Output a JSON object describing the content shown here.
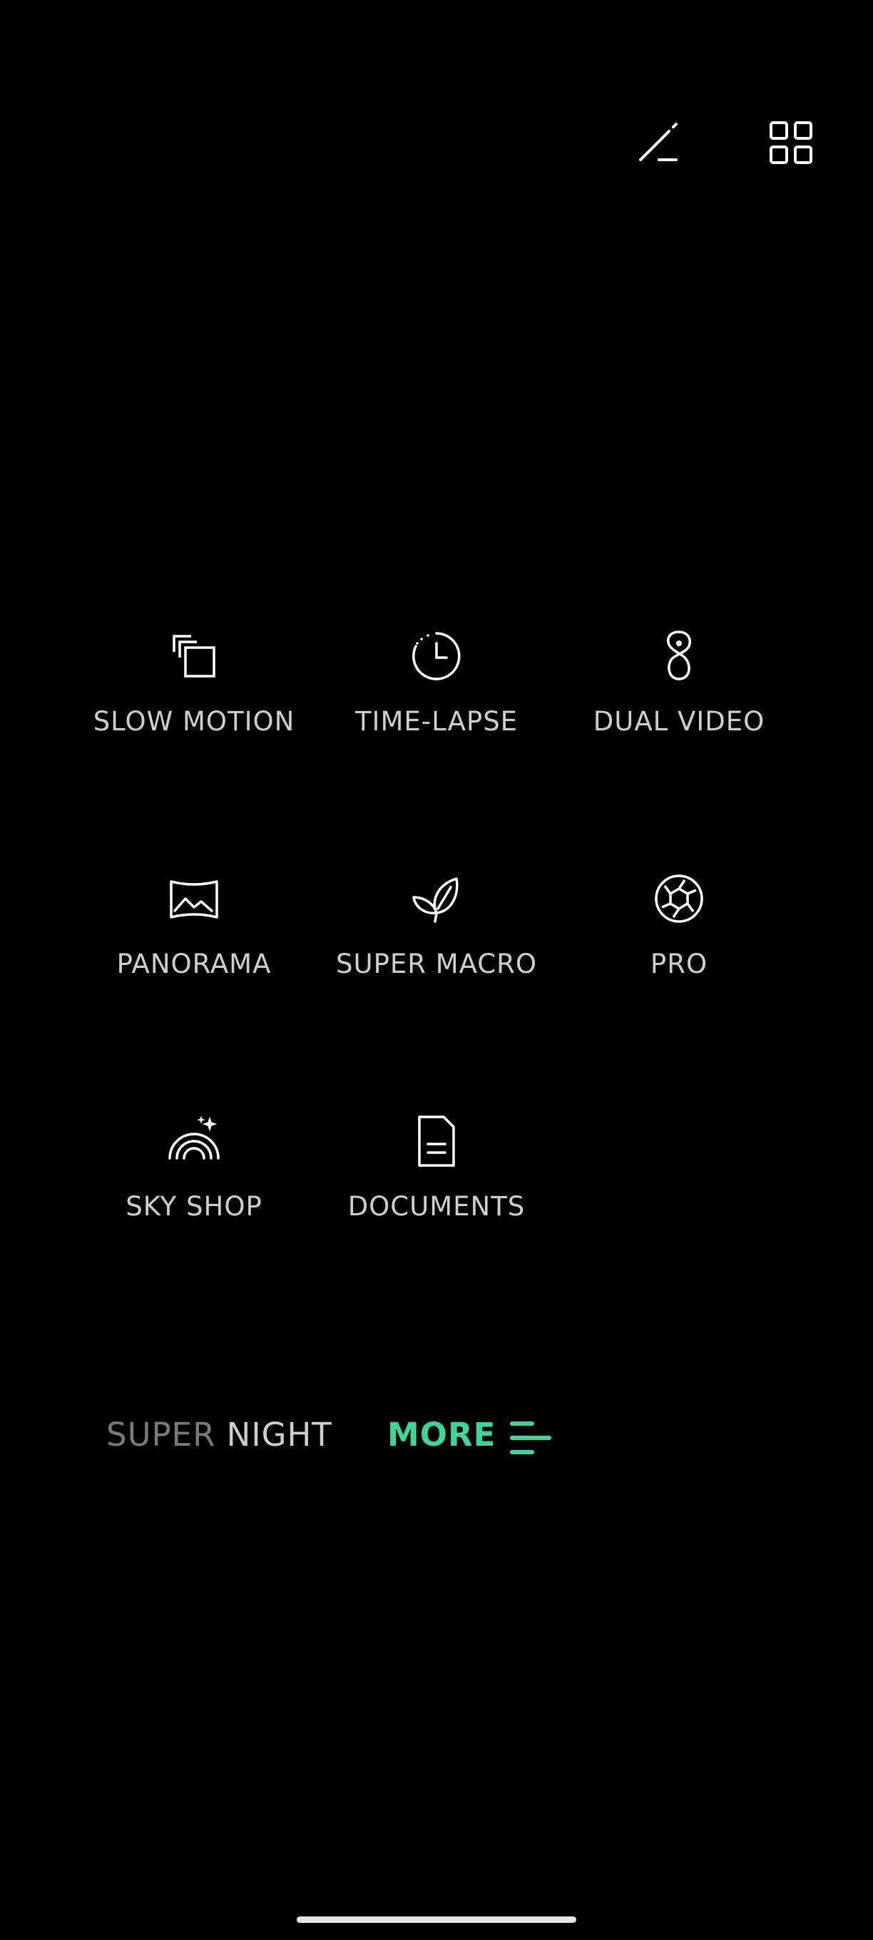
{
  "top_bar": {
    "edit_icon": "pencil-edit-icon",
    "grid_icon": "grid-layout-icon"
  },
  "modes": [
    {
      "label": "SLOW MOTION",
      "icon": "slow-motion-icon"
    },
    {
      "label": "TIME-LAPSE",
      "icon": "time-lapse-icon"
    },
    {
      "label": "DUAL VIDEO",
      "icon": "dual-video-icon"
    },
    {
      "label": "PANORAMA",
      "icon": "panorama-icon"
    },
    {
      "label": "SUPER MACRO",
      "icon": "super-macro-icon"
    },
    {
      "label": "PRO",
      "icon": "pro-aperture-icon"
    },
    {
      "label": "SKY SHOP",
      "icon": "sky-shop-icon"
    },
    {
      "label": "DOCUMENTS",
      "icon": "documents-icon"
    }
  ],
  "bottom_strip": {
    "prev_mode_part1": "SUPER",
    "prev_mode_part2": "NIGHT",
    "more_label": "MORE",
    "more_icon": "menu-lines-icon",
    "accent_color": "#3ed598"
  }
}
